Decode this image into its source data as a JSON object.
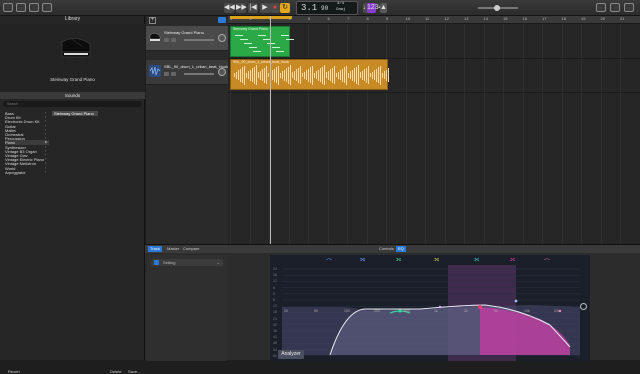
{
  "toolbar": {
    "lcd_bar": "3.1",
    "lcd_tempo": "90",
    "lcd_sig_top": "4/4",
    "lcd_sig_key": "Cmaj"
  },
  "library": {
    "title": "Library",
    "preview_name": "Steinway Grand Piano",
    "sounds_header": "Sounds",
    "search_placeholder": "Search",
    "categories": [
      "Bass",
      "Drum Kit",
      "Electronic Drum Kit",
      "Guitar",
      "Mallet",
      "Orchestral",
      "Percussion",
      "Piano",
      "Synthesizer",
      "Vintage B3 Organ",
      "Vintage Clav",
      "Vintage Electric Piano",
      "Vintage Mellotron",
      "World",
      "Arpeggiator"
    ],
    "selected_category_index": 7,
    "selected_sound": "Steinway Grand Piano",
    "revert_label": "Revert",
    "delete_label": "Delete",
    "save_label": "Save..."
  },
  "tracks": [
    {
      "name": "Steinway Grand Piano",
      "type": "software-instrument"
    },
    {
      "name": "SBL_90_drum_1_urban_beat_Hook",
      "type": "audio"
    }
  ],
  "ruler": {
    "marks": [
      "1",
      "2",
      "3",
      "4",
      "5",
      "6",
      "7",
      "8",
      "9",
      "10",
      "11",
      "12",
      "13",
      "14",
      "15",
      "16",
      "17",
      "18",
      "19",
      "20",
      "21"
    ]
  },
  "regions": {
    "midi_name": "Steinway Grand Piano",
    "audio_name": "SBL_90_drum_1_urban_beat_Hook"
  },
  "editor": {
    "tabs": [
      "Track",
      "Master",
      "Compare"
    ],
    "active_tab": "Track",
    "controls_label": "Controls",
    "eq_label": "EQ",
    "setting_label": "Setting",
    "analyzer_label": "Analyzer",
    "db_left": [
      "24",
      "18",
      "12",
      "6",
      "0",
      "6",
      "12",
      "18",
      "24",
      "30",
      "36",
      "42",
      "48",
      "54",
      "60"
    ],
    "freq_labels": [
      "20",
      "50",
      "100",
      "200",
      "500",
      "1k",
      "2k",
      "5k",
      "10k",
      "20k"
    ]
  },
  "colors": {
    "accent": "#2b7bd6",
    "midi_region": "#2aa946",
    "audio_region": "#c88a25",
    "cycle": "#d9a21a"
  }
}
